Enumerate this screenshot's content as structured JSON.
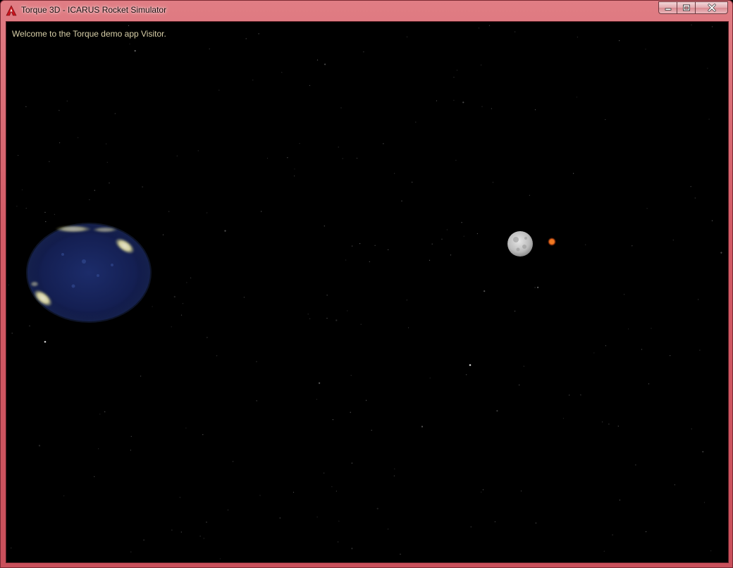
{
  "window": {
    "title": "Torque 3D - ICARUS Rocket Simulator",
    "icon": "torque-logo-icon",
    "frame_color": "#d25b66",
    "caption_buttons": {
      "minimize": "minimize-icon",
      "maximize": "maximize-icon",
      "close": "close-icon"
    }
  },
  "viewport": {
    "welcome_message": "Welcome to the Torque demo app Visitor.",
    "background_color": "#000000",
    "bodies": [
      "earth",
      "moon",
      "mars"
    ]
  }
}
